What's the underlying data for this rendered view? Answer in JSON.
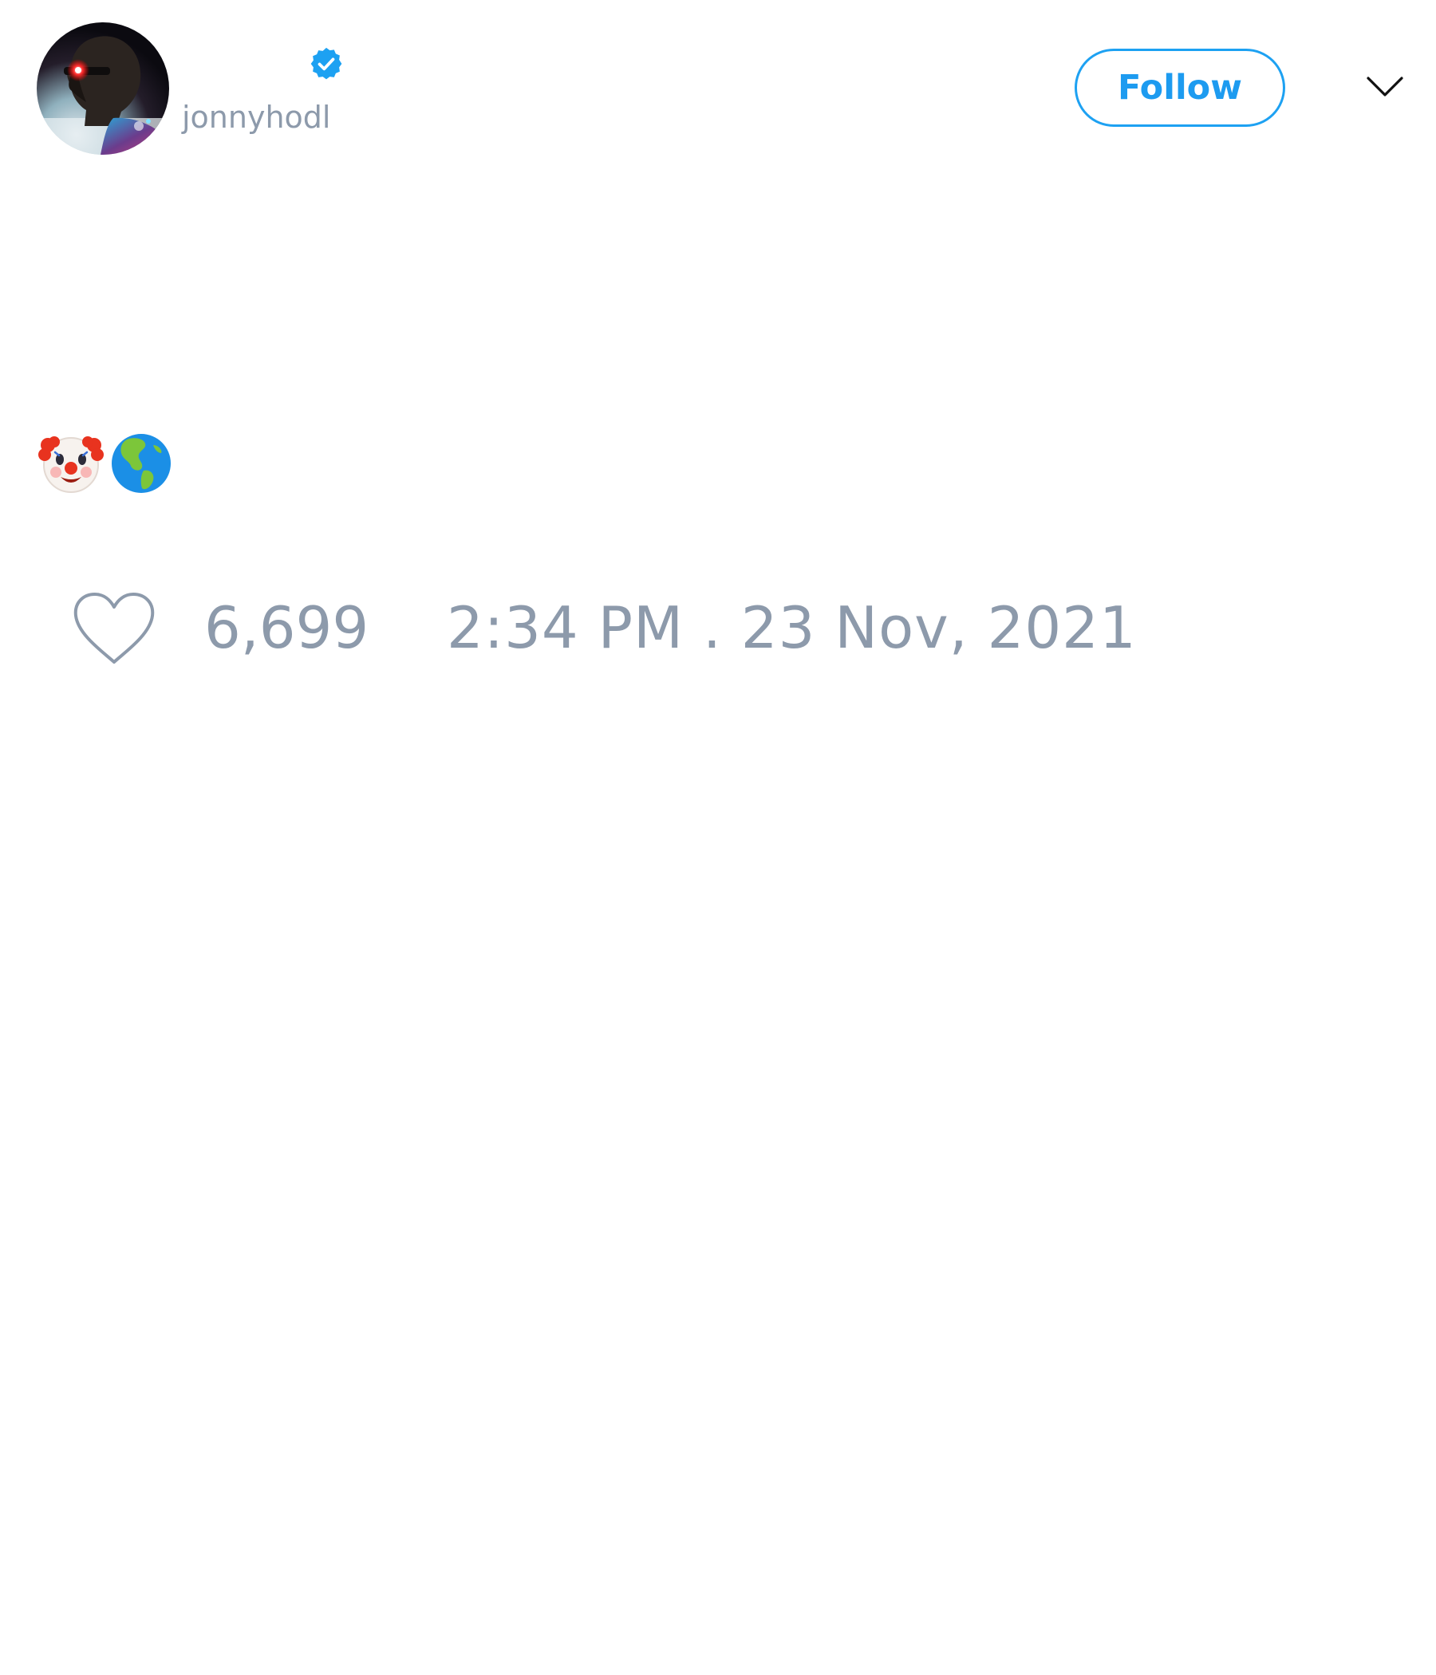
{
  "tweet": {
    "author": {
      "display_name": "",
      "handle": "jonnyhodl",
      "verified": true,
      "avatar_icon": "avatar-photo"
    },
    "follow_button_label": "Follow",
    "menu_icon": "chevron-down-icon",
    "text_emojis": [
      "clown-face",
      "globe-showing-americas"
    ],
    "likes": "6,699",
    "timestamp": "2:34 PM . 23 Nov, 2021"
  },
  "colors": {
    "accent": "#1da1f2",
    "muted_text": "#8d9aab",
    "background": "#ffffff"
  }
}
